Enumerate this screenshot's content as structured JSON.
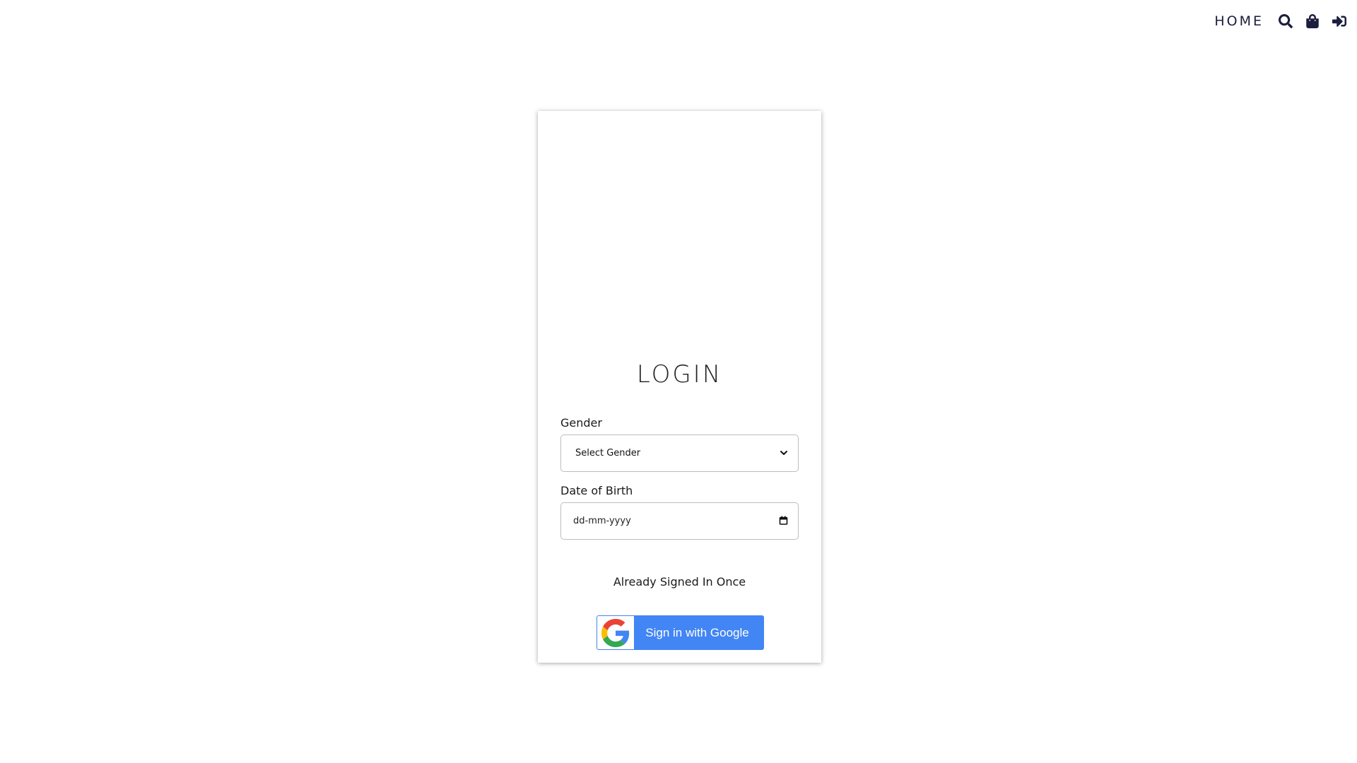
{
  "nav": {
    "home_label": "HOME",
    "icons": [
      "search-icon",
      "shopping-bag-icon",
      "sign-in-icon"
    ],
    "color": "#1b1e3d"
  },
  "login": {
    "title": "LOGIN",
    "gender": {
      "label": "Gender",
      "selected": "Select Gender"
    },
    "dob": {
      "label": "Date of Birth",
      "placeholder": "dd-mm-yyyy"
    },
    "already_text": "Already Signed In Once",
    "google_button": {
      "label": "Sign in with Google",
      "color": "#4285f4"
    }
  }
}
